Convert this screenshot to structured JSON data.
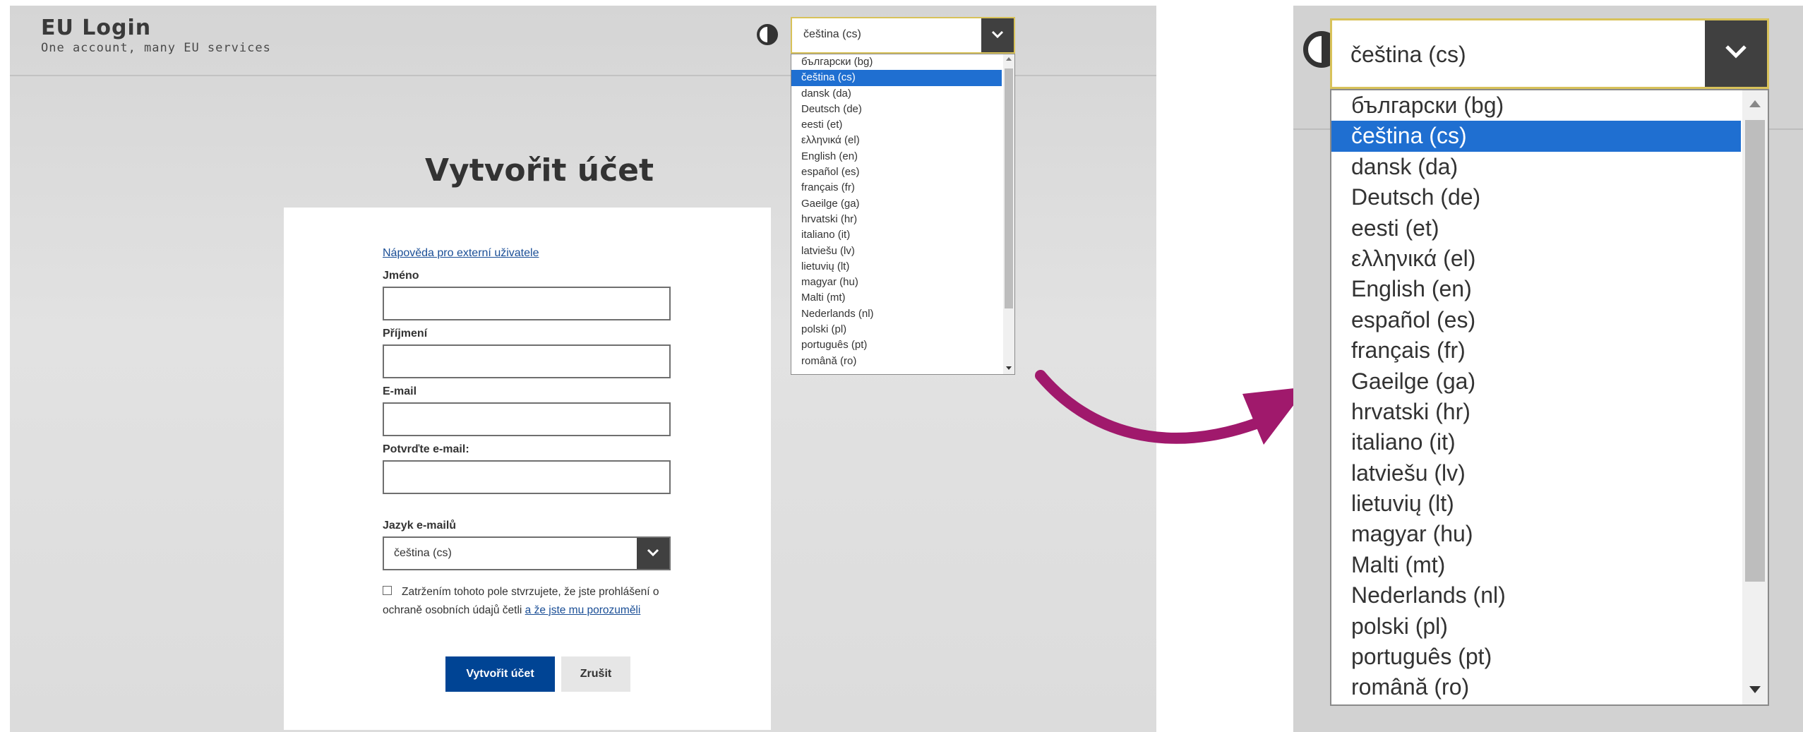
{
  "header": {
    "brand_title": "EU Login",
    "brand_tagline": "One account, many EU services",
    "contrast_icon": "contrast-half-circle-icon",
    "language_select": {
      "value": "čeština (cs)",
      "options": [
        "български (bg)",
        "čeština (cs)",
        "dansk (da)",
        "Deutsch (de)",
        "eesti (et)",
        "ελληνικά (el)",
        "English (en)",
        "español (es)",
        "français (fr)",
        "Gaeilge (ga)",
        "hrvatski (hr)",
        "italiano (it)",
        "latviešu (lv)",
        "lietuvių (lt)",
        "magyar (hu)",
        "Malti (mt)",
        "Nederlands (nl)",
        "polski (pl)",
        "português (pt)",
        "română (ro)"
      ],
      "selected_index": 1
    }
  },
  "main": {
    "title": "Vytvořit účet",
    "help_link": "Nápověda pro externí uživatele",
    "fields": {
      "first_name_label": "Jméno",
      "last_name_label": "Příjmení",
      "email_label": "E-mail",
      "confirm_email_label": "Potvrďte e-mail:",
      "email_language_label": "Jazyk e-mailů",
      "email_language_value": "čeština (cs)"
    },
    "consent": {
      "text": "Zatržením tohoto pole stvrzujete, že jste prohlášení o ochraně osobních údajů četli ",
      "link": "a že jste mu porozuměli"
    },
    "buttons": {
      "create": "Vytvořit účet",
      "cancel": "Zrušit"
    }
  },
  "colors": {
    "primary_button": "#004494",
    "selected_option": "#1f6fd1",
    "link": "#1a4e96",
    "select_focus_border": "#d8c25a",
    "arrow_annotation": "#a0196c"
  }
}
